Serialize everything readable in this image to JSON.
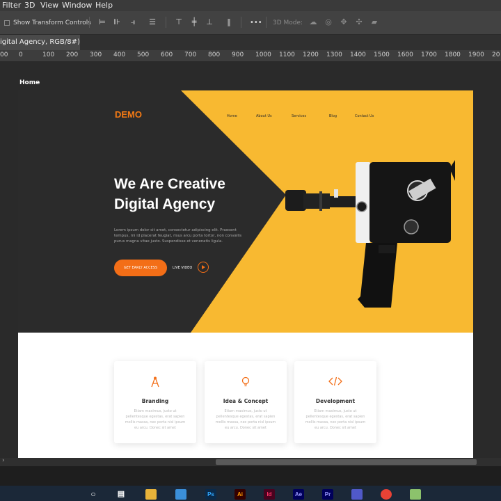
{
  "menu": [
    "Filter",
    "3D",
    "View",
    "Window",
    "Help"
  ],
  "options_bar": {
    "show_transform_controls": "Show Transform Controls",
    "mode_3d": "3D Mode:",
    "more": "•••"
  },
  "doc_tab": {
    "title": "igital Agency, RGB/8#)",
    "close": "×"
  },
  "ruler_ticks": [
    "00",
    "0",
    "100",
    "200",
    "300",
    "400",
    "500",
    "600",
    "700",
    "800",
    "900",
    "1000",
    "1100",
    "1200",
    "1300",
    "1400",
    "1500",
    "1600",
    "1700",
    "1800",
    "1900",
    "20"
  ],
  "artboard_label": "Home",
  "site": {
    "logo": "DEMO",
    "nav": [
      "Home",
      "About Us",
      "Services",
      "Blog",
      "Contact Us"
    ],
    "headline_1": "We Are Creative",
    "headline_2": "Digital Agency",
    "body": "Lorem ipsum dolor sit amet, consectetur adipiscing elit. Praesent tempus, mi id placerat feugiat, risus arcu porta tortor, non convallis purus magna vitae justo. Suspendisse et venenatis ligula.",
    "cta": "GET EARLY ACCESS",
    "live_video": "LIVE VIDEO",
    "cards": [
      {
        "icon": "compass-icon",
        "glyph": "⚞",
        "title": "Branding",
        "text": "Etiam maximus, justo ut pellentesque egestas, erat sapien mollis massa, nec porta nisl ipsum eu arcu. Donec sit amet"
      },
      {
        "icon": "lightbulb-icon",
        "glyph": "♁",
        "title": "Idea & Concept",
        "text": "Etiam maximus, justo ut pellentesque egestas, erat sapien mollis massa, nec porta nisl ipsum eu arcu. Donec sit amet"
      },
      {
        "icon": "code-icon",
        "glyph": "</>",
        "title": "Development",
        "text": "Etiam maximus, justo ut pellentesque egestas, erat sapien mollis massa, nec porta nisl ipsum eu arcu. Donec sit amet"
      }
    ],
    "colors": {
      "accent": "#f36e17",
      "yellow": "#f8b931",
      "dark": "#2b2b2b"
    }
  },
  "taskbar": {
    "apps": [
      "search-icon",
      "task-view-icon",
      "file-explorer-icon",
      "store-icon",
      "Ps",
      "Ai",
      "Id",
      "Ae",
      "Pr",
      "teams-icon",
      "chrome-icon",
      "notepad-icon"
    ]
  }
}
